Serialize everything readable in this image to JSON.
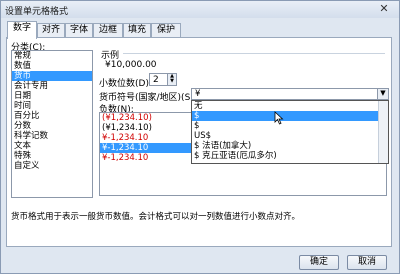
{
  "window": {
    "title": "设置单元格格式",
    "close_glyph": "✕"
  },
  "tabs": [
    "数字",
    "对齐",
    "字体",
    "边框",
    "填充",
    "保护"
  ],
  "category": {
    "label": "分类(C):",
    "items": [
      "常规",
      "数值",
      "货币",
      "会计专用",
      "日期",
      "时间",
      "百分比",
      "分数",
      "科学记数",
      "文本",
      "特殊",
      "自定义"
    ],
    "selected_index": 2
  },
  "sample": {
    "label": "示例",
    "value": "¥10,000.00"
  },
  "decimal": {
    "label": "小数位数(D):",
    "value": "2"
  },
  "currency_symbol": {
    "label": "货币符号(国家/地区)(S):",
    "value": "¥"
  },
  "negative": {
    "label": "负数(N):",
    "items": [
      "(¥1,234.10)",
      "(¥1,234.10)",
      "¥-1,234.10",
      "¥-1,234.10",
      "¥-1,234.10"
    ],
    "selected_index": 3
  },
  "dropdown": {
    "items": [
      "无",
      "$",
      "$",
      "US$",
      "$ 法语(加拿大)",
      "$ 克丘亚语(厄瓜多尔)"
    ],
    "selected_index": 1
  },
  "description": "货币格式用于表示一般货币数值。会计格式可以对一列数值进行小数点对齐。",
  "buttons": {
    "ok": "确定",
    "cancel": "取消"
  },
  "colors": {
    "selection": "#3399ff",
    "negative_red": "#d00000"
  }
}
